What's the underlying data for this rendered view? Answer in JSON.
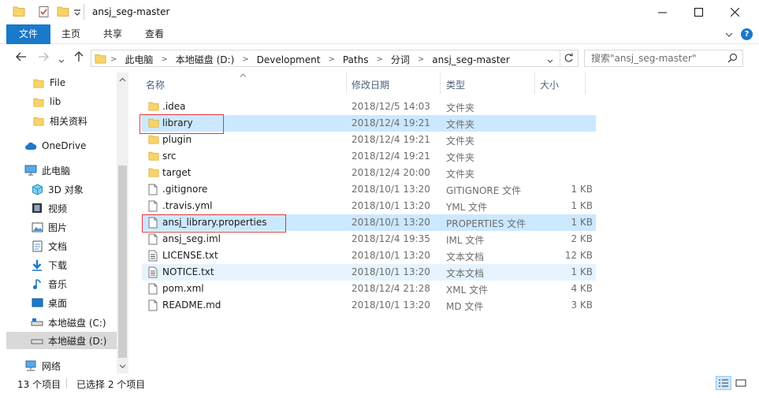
{
  "window": {
    "title": "ansj_seg-master"
  },
  "ribbon": {
    "tabs": [
      "文件",
      "主页",
      "共享",
      "查看"
    ],
    "help": "?"
  },
  "address": {
    "path": [
      "此电脑",
      "本地磁盘 (D:)",
      "Development",
      "Paths",
      "分词",
      "ansj_seg-master"
    ],
    "search_placeholder": "搜索\"ansj_seg-master\""
  },
  "navpane": {
    "items": [
      {
        "label": "File",
        "icon": "folder-icon"
      },
      {
        "label": "lib",
        "icon": "folder-icon"
      },
      {
        "label": "相关资料",
        "icon": "folder-icon"
      },
      {
        "label": "OneDrive",
        "icon": "cloud-icon"
      },
      {
        "label": "此电脑",
        "icon": "computer-icon"
      },
      {
        "label": "3D 对象",
        "icon": "cube-icon"
      },
      {
        "label": "视频",
        "icon": "video-icon"
      },
      {
        "label": "图片",
        "icon": "picture-icon"
      },
      {
        "label": "文档",
        "icon": "document-icon"
      },
      {
        "label": "下载",
        "icon": "download-icon"
      },
      {
        "label": "音乐",
        "icon": "music-icon"
      },
      {
        "label": "桌面",
        "icon": "desktop-icon"
      },
      {
        "label": "本地磁盘 (C:)",
        "icon": "drive-icon"
      },
      {
        "label": "本地磁盘 (D:)",
        "icon": "drive-icon"
      },
      {
        "label": "网络",
        "icon": "network-icon"
      }
    ]
  },
  "columns": {
    "name": "名称",
    "date": "修改日期",
    "type": "类型",
    "size": "大小"
  },
  "files": [
    {
      "name": ".idea",
      "date": "2018/12/5 14:03",
      "type": "文件夹",
      "size": "",
      "kind": "folder"
    },
    {
      "name": "library",
      "date": "2018/12/4 19:21",
      "type": "文件夹",
      "size": "",
      "kind": "folder"
    },
    {
      "name": "plugin",
      "date": "2018/12/4 19:21",
      "type": "文件夹",
      "size": "",
      "kind": "folder"
    },
    {
      "name": "src",
      "date": "2018/12/4 19:21",
      "type": "文件夹",
      "size": "",
      "kind": "folder"
    },
    {
      "name": "target",
      "date": "2018/12/4 20:00",
      "type": "文件夹",
      "size": "",
      "kind": "folder"
    },
    {
      "name": ".gitignore",
      "date": "2018/10/1 13:20",
      "type": "GITIGNORE 文件",
      "size": "1 KB",
      "kind": "file"
    },
    {
      "name": ".travis.yml",
      "date": "2018/10/1 13:20",
      "type": "YML 文件",
      "size": "1 KB",
      "kind": "file"
    },
    {
      "name": "ansj_library.properties",
      "date": "2018/10/1 13:20",
      "type": "PROPERTIES 文件",
      "size": "1 KB",
      "kind": "file"
    },
    {
      "name": "ansj_seg.iml",
      "date": "2018/12/4 19:35",
      "type": "IML 文件",
      "size": "2 KB",
      "kind": "file"
    },
    {
      "name": "LICENSE.txt",
      "date": "2018/10/1 13:20",
      "type": "文本文档",
      "size": "12 KB",
      "kind": "text"
    },
    {
      "name": "NOTICE.txt",
      "date": "2018/10/1 13:20",
      "type": "文本文档",
      "size": "1 KB",
      "kind": "text"
    },
    {
      "name": "pom.xml",
      "date": "2018/12/4 21:28",
      "type": "XML 文件",
      "size": "4 KB",
      "kind": "file"
    },
    {
      "name": "README.md",
      "date": "2018/10/1 13:20",
      "type": "MD 文件",
      "size": "3 KB",
      "kind": "file"
    }
  ],
  "status": {
    "count": "13 个项目",
    "selected": "已选择 2 个项目"
  },
  "colors": {
    "accent": "#1979ca",
    "selection": "#cce8ff",
    "hover": "#e5f3ff",
    "highlight_box": "#e0383e",
    "folder": "#f6d46b"
  }
}
